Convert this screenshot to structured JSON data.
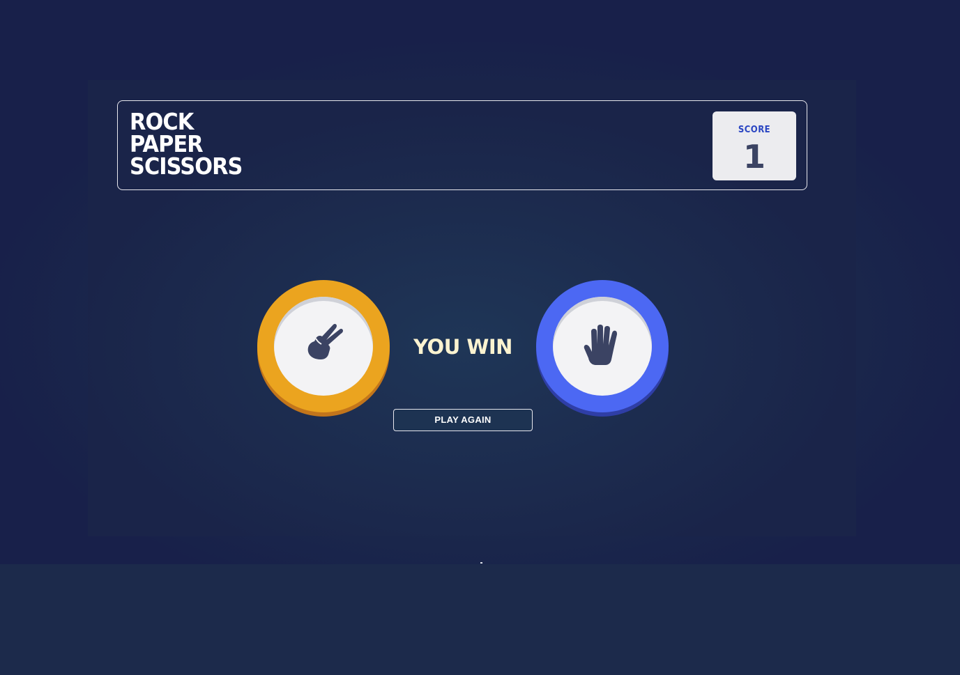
{
  "game": {
    "title_lines": [
      "ROCK",
      "PAPER",
      "SCISSORS"
    ],
    "score_label": "SCORE",
    "score_value": "1",
    "player_pick": {
      "name": "scissors",
      "icon": "scissors-hand-icon",
      "ring_color": "#eba41f"
    },
    "house_pick": {
      "name": "paper",
      "icon": "paper-hand-icon",
      "ring_color": "#4c68f3"
    },
    "result_text": "YOU WIN",
    "play_again_label": "PLAY AGAIN"
  },
  "colors": {
    "background": "#1c2a4b",
    "score_label": "#2a45c2",
    "score_value": "#3b4363",
    "result_text": "#fbf3d0",
    "icon": "#3b4363"
  }
}
